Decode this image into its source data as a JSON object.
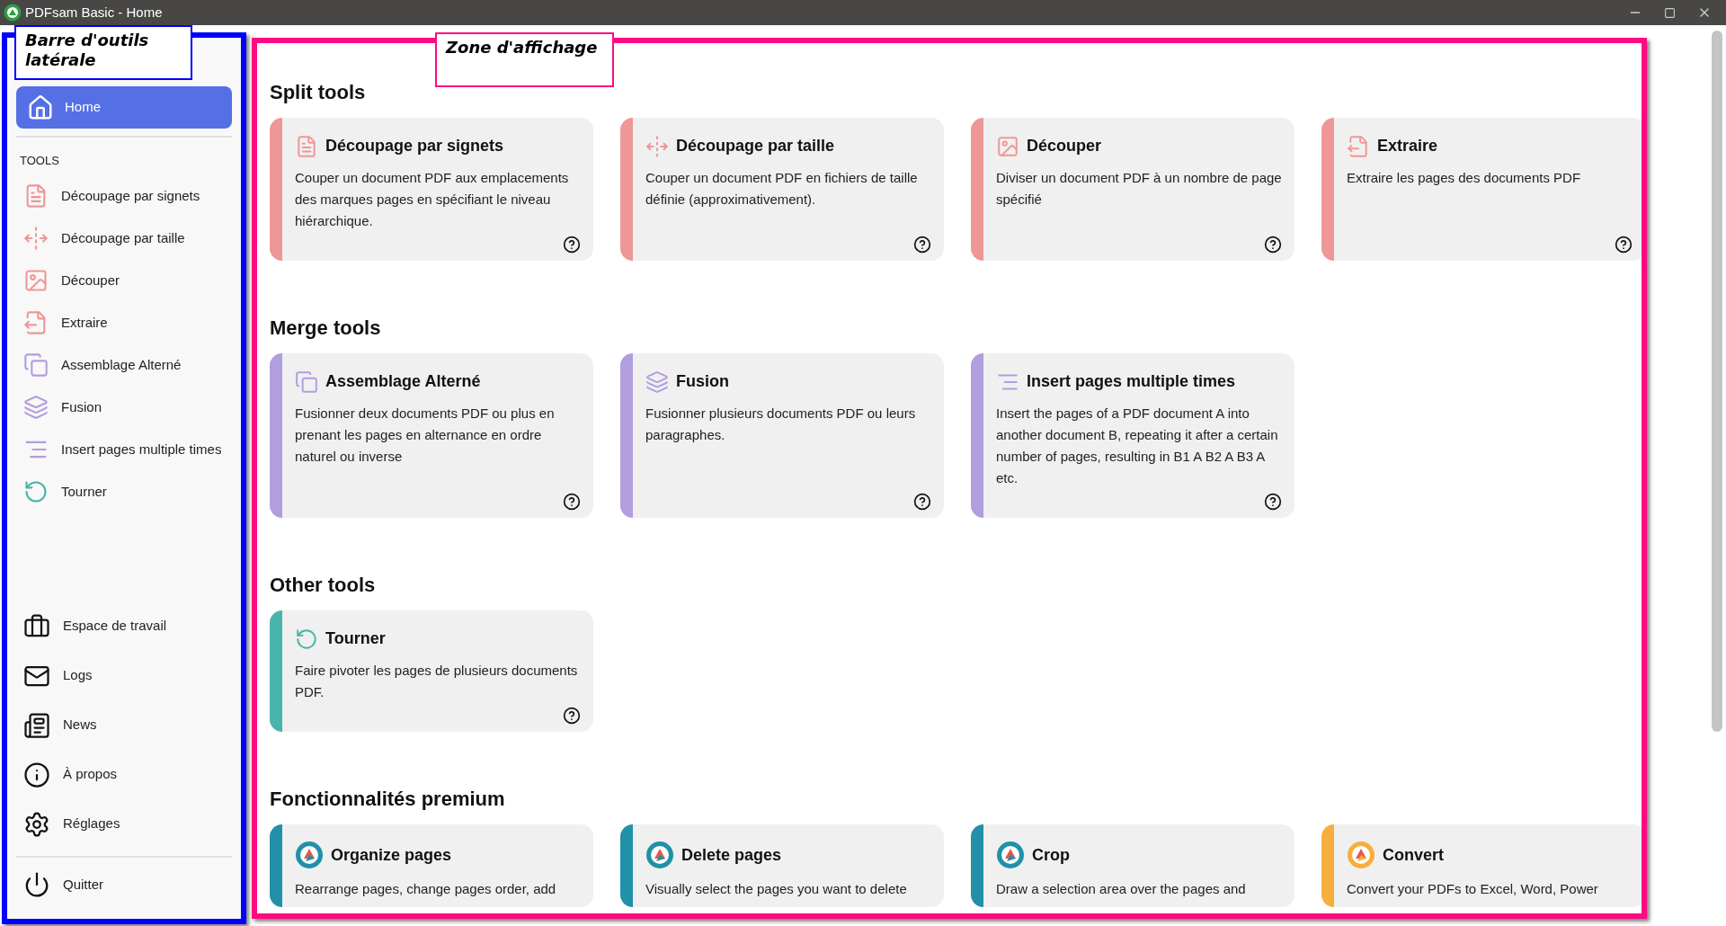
{
  "window": {
    "title": "PDFsam Basic - Home"
  },
  "annotations": [
    {
      "text": "Barre d'outils latérale",
      "color": "#0000ff",
      "kind": "sidebar"
    },
    {
      "text": "Zone d'affichage",
      "color": "#ff0a82",
      "kind": "main"
    }
  ],
  "sidebar": {
    "home": {
      "label": "Home",
      "selected": true
    },
    "section": "TOOLS",
    "tools": [
      {
        "label": "Découpage par signets",
        "kind": "bookmarks",
        "color": "#ee9797"
      },
      {
        "label": "Découpage par taille",
        "kind": "size",
        "color": "#ee9797"
      },
      {
        "label": "Découper",
        "kind": "split",
        "color": "#ee9797"
      },
      {
        "label": "Extraire",
        "kind": "extract",
        "color": "#ee9797"
      },
      {
        "label": "Assemblage Alterné",
        "kind": "alternate",
        "color": "#b29ddf"
      },
      {
        "label": "Fusion",
        "kind": "merge",
        "color": "#b29ddf"
      },
      {
        "label": "Insert pages multiple times",
        "kind": "insert",
        "color": "#b29ddf"
      },
      {
        "label": "Tourner",
        "kind": "rotate",
        "color": "#48b5aa"
      }
    ],
    "bottom": [
      {
        "label": "Espace de travail",
        "kind": "workspace"
      },
      {
        "label": "Logs",
        "kind": "logs"
      },
      {
        "label": "News",
        "kind": "news"
      },
      {
        "label": "À propos",
        "kind": "about"
      },
      {
        "label": "Réglages",
        "kind": "settings"
      }
    ],
    "quit": {
      "label": "Quitter",
      "kind": "quit"
    }
  },
  "sections": [
    {
      "title": "Split tools",
      "cards": [
        {
          "title": "Découpage par signets",
          "description": "Couper un document PDF aux emplacements des marques pages en spécifiant le niveau hiérarchique.",
          "kind": "bookmarks",
          "color": "#ee9797",
          "help": true
        },
        {
          "title": "Découpage par taille",
          "description": "Couper un document PDF en fichiers de taille définie (approximativement).",
          "kind": "size",
          "color": "#ee9797",
          "help": true
        },
        {
          "title": "Découper",
          "description": "Diviser un document PDF à un nombre de page spécifié",
          "kind": "split",
          "color": "#ee9797",
          "help": true
        },
        {
          "title": "Extraire",
          "description": "Extraire les pages des documents PDF",
          "kind": "extract",
          "color": "#ee9797",
          "help": true
        }
      ]
    },
    {
      "title": "Merge tools",
      "cards": [
        {
          "title": "Assemblage Alterné",
          "description": "Fusionner deux documents PDF ou plus en prenant les pages en alternance en ordre naturel ou inverse",
          "kind": "alternate",
          "color": "#b29ddf",
          "help": true
        },
        {
          "title": "Fusion",
          "description": "Fusionner plusieurs documents PDF ou leurs paragraphes.",
          "kind": "merge",
          "color": "#b29ddf",
          "help": true
        },
        {
          "title": "Insert pages multiple times",
          "description": "Insert the pages of a PDF document A into another document B, repeating it after a certain number of pages, resulting in B1 A B2 A B3 A etc.",
          "kind": "insert",
          "color": "#b29ddf",
          "help": true
        }
      ]
    },
    {
      "title": "Other tools",
      "cards": [
        {
          "title": "Tourner",
          "description": "Faire pivoter les pages de plusieurs documents PDF.",
          "kind": "rotate",
          "color": "#48b5aa",
          "help": true
        }
      ]
    },
    {
      "title": "Fonctionnalités premium",
      "cards": [
        {
          "title": "Organize pages",
          "description": "Rearrange pages, change pages order, add",
          "kind": "premium",
          "color": "#2190a8",
          "help": false
        },
        {
          "title": "Delete pages",
          "description": "Visually select the pages you want to delete",
          "kind": "premium",
          "color": "#2190a8",
          "help": false
        },
        {
          "title": "Crop",
          "description": "Draw a selection area over the pages and",
          "kind": "premium",
          "color": "#2190a8",
          "help": false
        },
        {
          "title": "Convert",
          "description": "Convert your PDFs to Excel, Word, Power",
          "kind": "premium",
          "color": "#f7ae3c",
          "help": false
        }
      ]
    }
  ]
}
